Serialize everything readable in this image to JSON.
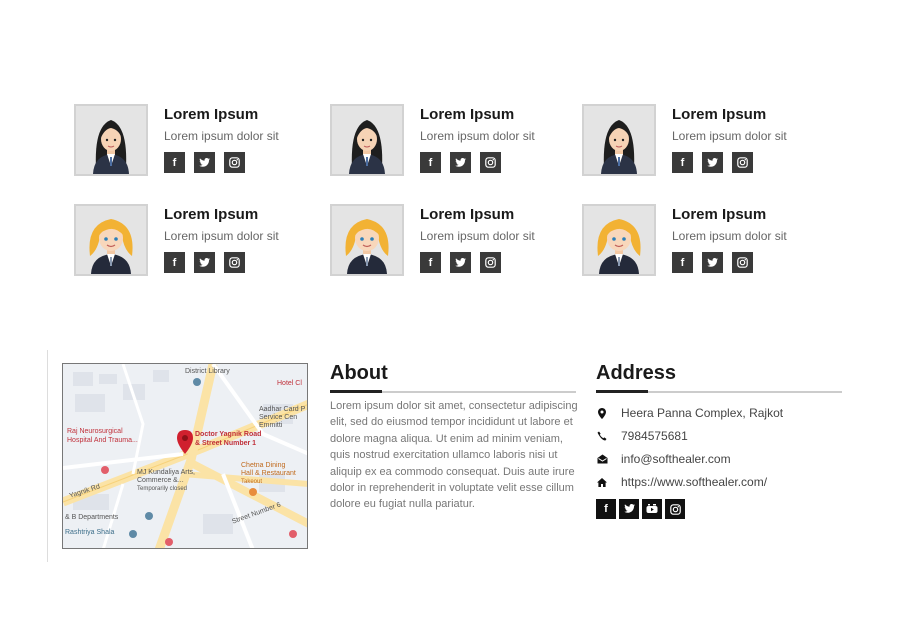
{
  "team": {
    "members": [
      {
        "name": "Lorem Ipsum",
        "role": "Lorem ipsum dolor sit",
        "avatar": "woman-dark-hair-avatar"
      },
      {
        "name": "Lorem Ipsum",
        "role": "Lorem ipsum dolor sit",
        "avatar": "woman-dark-hair-avatar"
      },
      {
        "name": "Lorem Ipsum",
        "role": "Lorem ipsum dolor sit",
        "avatar": "woman-dark-hair-avatar"
      },
      {
        "name": "Lorem Ipsum",
        "role": "Lorem ipsum dolor sit",
        "avatar": "woman-blonde-hair-avatar"
      },
      {
        "name": "Lorem Ipsum",
        "role": "Lorem ipsum dolor sit",
        "avatar": "woman-blonde-hair-avatar"
      },
      {
        "name": "Lorem Ipsum",
        "role": "Lorem ipsum dolor sit",
        "avatar": "woman-blonde-hair-avatar"
      }
    ],
    "social_icons": [
      "facebook-icon",
      "twitter-icon",
      "instagram-icon"
    ]
  },
  "map": {
    "pin_label_1": "Doctor Yagnik Road",
    "pin_label_2": "& Street Number 1",
    "labels": {
      "district_library": "District Library",
      "hotel": "Hotel Cl",
      "aadhar_1": "Aadhar Card P",
      "aadhar_2": "Service Cen",
      "aadhar_3": "Emmitti",
      "raj_1": "Raj Neurosurgical",
      "raj_2": "Hospital And Trauma...",
      "mj_1": "MJ Kundaliya Arts,",
      "mj_2": "Commerce &...",
      "mj_3": "Temporarily closed",
      "chetna_1": "Chetna Dining",
      "chetna_2": "Hall & Restaurant",
      "chetna_3": "Takeout",
      "yagnik_rd": "Yagnik Rd",
      "street_number": "Street Number 6",
      "departments": "& B Departments",
      "rashtriya": "Rashtriya Shala"
    }
  },
  "about": {
    "title": "About",
    "text": "Lorem ipsum dolor sit amet, consectetur adipiscing elit, sed do eiusmod tempor incididunt ut labore et dolore magna aliqua. Ut enim ad minim veniam, quis nostrud exercitation ullamco laboris nisi ut aliquip ex ea commodo consequat. Duis aute irure dolor in reprehenderit in voluptate velit esse cillum dolore eu fugiat nulla pariatur."
  },
  "address": {
    "title": "Address",
    "location": "Heera Panna Complex, Rajkot",
    "phone": "7984575681",
    "email": "info@softhealer.com",
    "website": "https://www.softhealer.com/",
    "social_icons": [
      "facebook-icon",
      "twitter-icon",
      "youtube-icon",
      "instagram-icon"
    ]
  },
  "colors": {
    "social_button": "#3a3a3a",
    "address_social_button": "#111111",
    "heading_accent": "#222222",
    "map_pin": "#d0202e"
  }
}
